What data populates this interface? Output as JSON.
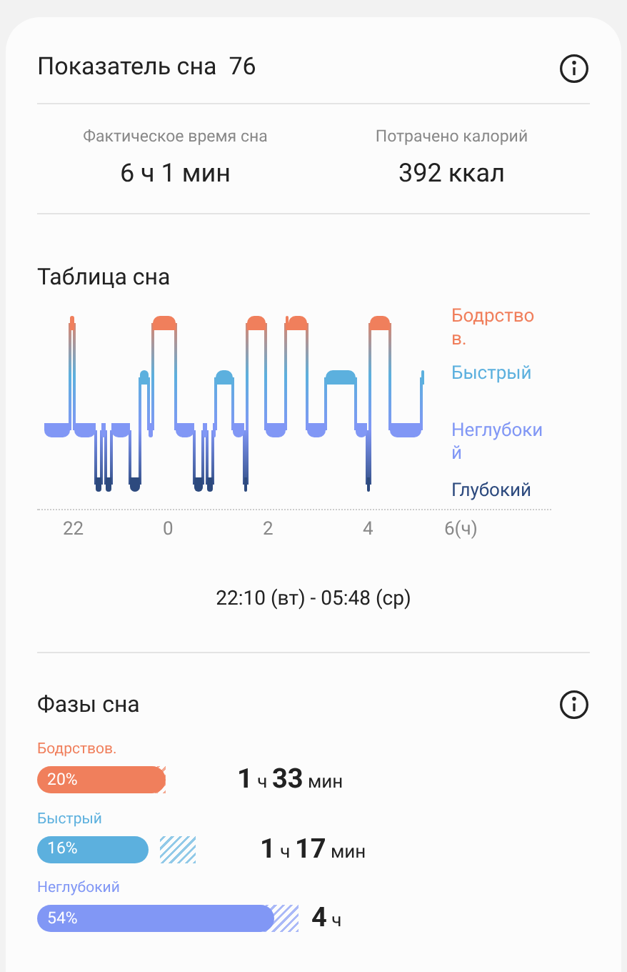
{
  "score": {
    "title": "Показатель сна",
    "value": "76"
  },
  "stats": [
    {
      "label": "Фактическое время сна",
      "value": "6 ч 1 мин"
    },
    {
      "label": "Потрачено калорий",
      "value": "392 ккал"
    }
  ],
  "sleep_chart": {
    "title": "Таблица сна",
    "stages": [
      {
        "label": "Бодрство в.",
        "color": "#f07f5c"
      },
      {
        "label": "Быстрый",
        "color": "#5cb0de"
      },
      {
        "label": "Неглубоки й",
        "color": "#8197f5"
      },
      {
        "label": "Глубокий",
        "color": "#2d4a7e"
      }
    ],
    "ticks": [
      "22",
      "0",
      "2",
      "4",
      "6(ч)"
    ],
    "range": "22:10 (вт) - 05:48 (ср)"
  },
  "phases": {
    "title": "Фазы сна",
    "items": [
      {
        "label": "Бодрствов.",
        "percent": "20%",
        "color": "#f07f5c",
        "duration": [
          {
            "n": "1",
            "u": "ч"
          },
          {
            "n": "33",
            "u": "мин"
          }
        ]
      },
      {
        "label": "Быстрый",
        "percent": "16%",
        "color": "#5cb0de",
        "duration": [
          {
            "n": "1",
            "u": "ч"
          },
          {
            "n": "17",
            "u": "мин"
          }
        ]
      },
      {
        "label": "Неглубокий",
        "percent": "54%",
        "color": "#8197f5",
        "duration": [
          {
            "n": "4",
            "u": "ч"
          }
        ]
      }
    ]
  }
}
